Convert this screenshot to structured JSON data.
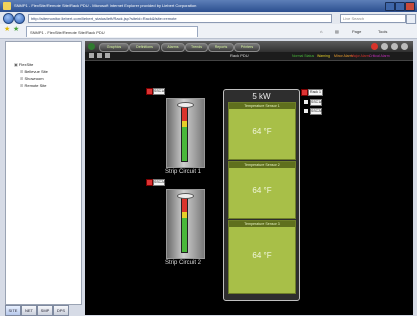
{
  "window": {
    "title": "SNMP1 - FlexSite/Remote Site/Rack PDU - Microsoft Internet Explorer provided by Liebert Corporation"
  },
  "browser": {
    "address": "http://sitemonitor.liebert.com/liebert_status/left/Rack.jsp?siteid=Rack&fsite=remote",
    "search_placeholder": "Live Search",
    "tab_label": "SNMP1 - FlexSite/Remote Site/Rack PDU",
    "toolbar": {
      "page": "Page",
      "tools": "Tools"
    }
  },
  "tree": {
    "root": "FlexSite",
    "items": [
      {
        "label": "Bellevue Site"
      },
      {
        "label": "Showroom"
      },
      {
        "label": "Remote Site"
      }
    ]
  },
  "bottom_tabs": [
    "SITE",
    "NET",
    "SMP",
    "DPS"
  ],
  "nav": {
    "items": [
      "Graphics",
      "Definitions",
      "Alarms",
      "Trends",
      "Reports",
      "Printers"
    ],
    "view_title": "Rack PDU",
    "legend": [
      "Normal Status",
      "Warning",
      "Minor Alarm",
      "Major Alarm",
      "Critical Alarm",
      "No Communication",
      "Disabled"
    ]
  },
  "strips": [
    {
      "name": "Strip Circuit 1",
      "tag": "SSC1A"
    },
    {
      "name": "Strip Circuit 2",
      "tag": "SSC2A"
    }
  ],
  "rack": {
    "power": "5 kW",
    "sensors": [
      {
        "name": "Temperature Sensor 1",
        "value": "64 °F"
      },
      {
        "name": "Temperature Sensor 2",
        "value": "64 °F"
      },
      {
        "name": "Temperature Sensor 3",
        "value": "64 °F"
      }
    ]
  },
  "rack_tags": {
    "main": "Rack 1",
    "sub1": "SSC1A",
    "sub2": "SSC2A"
  },
  "colors": {
    "sensor_bg": "#a8bf48",
    "gauge_green": "#49b83a",
    "gauge_red": "#d9342b",
    "gauge_yellow": "#e6cf28"
  }
}
